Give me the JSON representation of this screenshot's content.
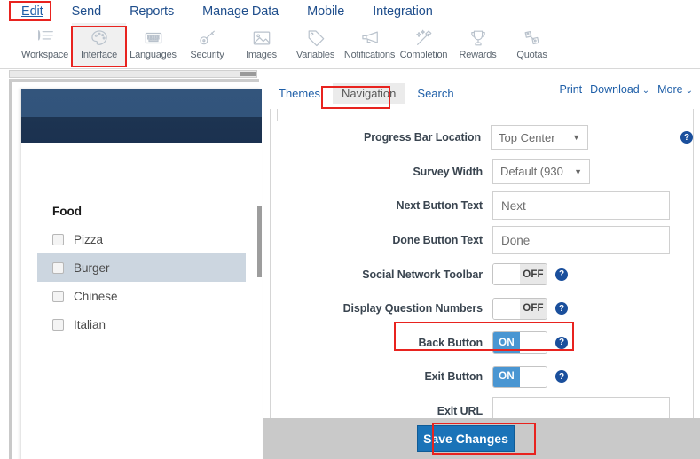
{
  "topmenu": {
    "items": [
      {
        "label": "Edit",
        "active": true
      },
      {
        "label": "Send",
        "active": false
      },
      {
        "label": "Reports",
        "active": false
      },
      {
        "label": "Manage Data",
        "active": false
      },
      {
        "label": "Mobile",
        "active": false
      },
      {
        "label": "Integration",
        "active": false
      }
    ]
  },
  "toolbar": {
    "items": [
      {
        "label": "Workspace",
        "icon": "pen-list-icon",
        "selected": false
      },
      {
        "label": "Interface",
        "icon": "palette-icon",
        "selected": true
      },
      {
        "label": "Languages",
        "icon": "keyboard-icon",
        "selected": false
      },
      {
        "label": "Security",
        "icon": "key-icon",
        "selected": false
      },
      {
        "label": "Images",
        "icon": "image-icon",
        "selected": false
      },
      {
        "label": "Variables",
        "icon": "tag-icon",
        "selected": false
      },
      {
        "label": "Notifications",
        "icon": "megaphone-icon",
        "selected": false
      },
      {
        "label": "Completion",
        "icon": "magic-wand-icon",
        "selected": false
      },
      {
        "label": "Rewards",
        "icon": "trophy-icon",
        "selected": false
      },
      {
        "label": "Quotas",
        "icon": "links-icon",
        "selected": false
      }
    ]
  },
  "preview": {
    "question_title": "Food",
    "options": [
      {
        "label": "Pizza",
        "highlighted": false
      },
      {
        "label": "Burger",
        "highlighted": true
      },
      {
        "label": "Chinese",
        "highlighted": false
      },
      {
        "label": "Italian",
        "highlighted": false
      }
    ]
  },
  "subtabs": [
    {
      "label": "Themes",
      "active": false
    },
    {
      "label": "Navigation",
      "active": true
    },
    {
      "label": "Search",
      "active": false
    }
  ],
  "actions": [
    {
      "label": "Print",
      "caret": false
    },
    {
      "label": "Download",
      "caret": true
    },
    {
      "label": "More",
      "caret": true
    }
  ],
  "form": {
    "rows": [
      {
        "label": "Progress Bar Location",
        "type": "select",
        "value": "Top Center",
        "help": true
      },
      {
        "label": "Survey Width",
        "type": "select",
        "value": "Default (930",
        "help": false
      },
      {
        "label": "Next Button Text",
        "type": "text",
        "value": "Next",
        "help": false
      },
      {
        "label": "Done Button Text",
        "type": "text",
        "value": "Done",
        "help": false
      },
      {
        "label": "Social Network Toolbar",
        "type": "toggle",
        "value": "OFF",
        "help": true
      },
      {
        "label": "Display Question Numbers",
        "type": "toggle",
        "value": "OFF",
        "help": true
      },
      {
        "label": "Back Button",
        "type": "toggle",
        "value": "ON",
        "help": true
      },
      {
        "label": "Exit Button",
        "type": "toggle",
        "value": "ON",
        "help": true
      },
      {
        "label": "Exit URL",
        "type": "text",
        "value": "",
        "help": false
      }
    ]
  },
  "footer": {
    "save_label": "Save Changes"
  },
  "colors": {
    "accent_blue": "#1f5fa8",
    "toggle_on": "#4a96d2",
    "save_button": "#1a73b8",
    "highlight_red": "#e8231f",
    "preview_header": "#33557c",
    "footer_gray": "#c9c9c9"
  },
  "help_glyph": "?"
}
